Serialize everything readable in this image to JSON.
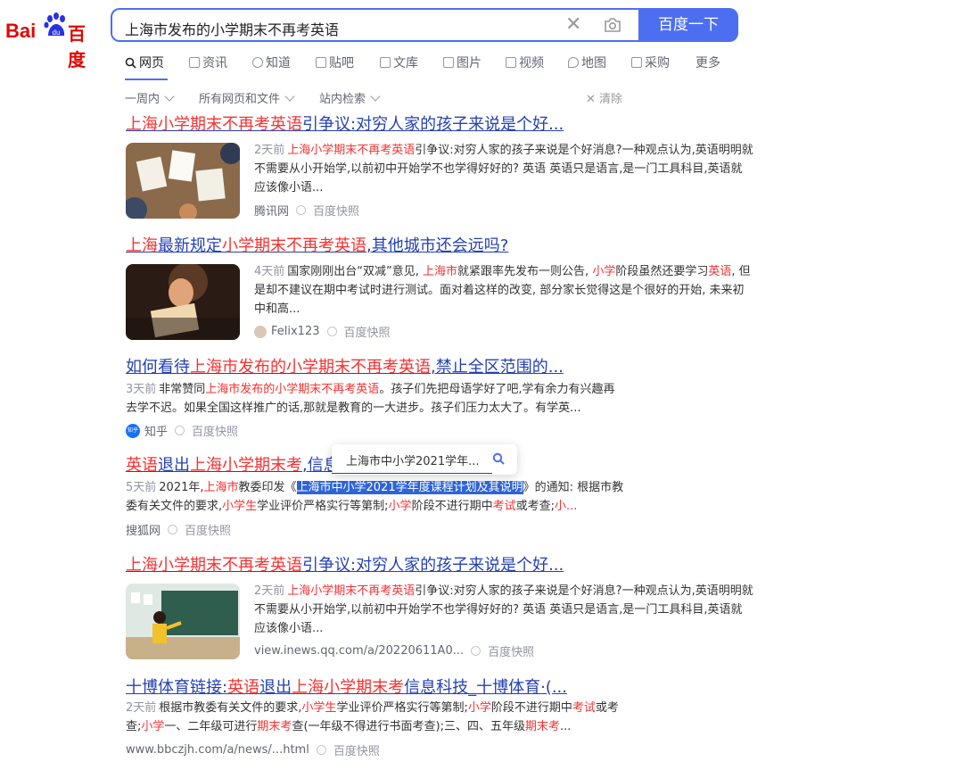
{
  "logo": {
    "latin": "Bai",
    "paw_letters": "du",
    "chinese": "百度"
  },
  "search": {
    "query": "上海市发布的小学期末不再考英语",
    "button": "百度一下"
  },
  "tabs": [
    "网页",
    "资讯",
    "知道",
    "贴吧",
    "文库",
    "图片",
    "视频",
    "地图",
    "采购",
    "更多"
  ],
  "filters": {
    "time": "一周内",
    "type": "所有网页和文件",
    "site": "站内检索",
    "clear": "清除"
  },
  "snapshot_label": "百度快照",
  "results": [
    {
      "title_parts": [
        [
          "上海小学期末不再考英语",
          true
        ],
        [
          "引争议:对穷人家的孩子来说是个好...",
          false
        ]
      ],
      "date": "2天前",
      "snippet_parts": [
        [
          "上海小学期末不再考英语",
          true
        ],
        [
          "引争议:对穷人家的孩子来说是个好消息?一种观点认为,英语明明就不需要从小开始学,以前初中开始学不也学得好好的? 英语 英语只是语言,是一门工具科目,英语就应该像小语...",
          false
        ]
      ],
      "source": "腾讯网"
    },
    {
      "title_parts": [
        [
          "上海",
          true
        ],
        [
          "最新规定",
          false
        ],
        [
          "小学期末不再考英语",
          true
        ],
        [
          ",其他城市还会远吗?",
          false
        ]
      ],
      "date": "4天前",
      "snippet_parts": [
        [
          "国家刚刚出台“双减”意见, ",
          false
        ],
        [
          "上海市",
          true
        ],
        [
          "就紧跟率先发布一则公告, ",
          false
        ],
        [
          "小学",
          true
        ],
        [
          "阶段虽然还要学习",
          false
        ],
        [
          "英语",
          true
        ],
        [
          ", 但是却不建议在期中考试时进行测试。面对着这样的改变, 部分家长觉得这是个很好的开始, 未来初中和高...",
          false
        ]
      ],
      "source": "Felix123"
    },
    {
      "title_parts": [
        [
          "如何看待",
          false
        ],
        [
          "上海市发布的小学期末不再考英语",
          true
        ],
        [
          ",禁止全区范围的...",
          false
        ]
      ],
      "date": "3天前",
      "snippet_parts": [
        [
          "非常赞同",
          false
        ],
        [
          "上海市发布的小学期末不再考英语",
          true
        ],
        [
          "。孩子们先把母语学好了吧,学有余力有兴趣再去学不迟。如果全国这样推广的话,那就是教育的一大进步。孩子们压力太大了。有学英...",
          false
        ]
      ],
      "source": "知乎",
      "source_badge": "知乎"
    },
    {
      "title_parts": [
        [
          "英语",
          true
        ],
        [
          "退出",
          false
        ],
        [
          "上海小学期末考",
          true
        ],
        [
          ",信息",
          false
        ]
      ],
      "date": "5天前",
      "snippet_parts": [
        [
          "2021年,",
          false
        ],
        [
          "上海市",
          true
        ],
        [
          "教委印发《",
          false
        ],
        [
          "上海市中小学2021学年度课程计划及其说明",
          "sel"
        ],
        [
          "》的通知: 根据市教委有关文件的要求,",
          false
        ],
        [
          "小学生",
          true
        ],
        [
          "学业评价严格实行等第制;",
          false
        ],
        [
          "小学",
          true
        ],
        [
          "阶段不进行期中",
          false
        ],
        [
          "考试",
          true
        ],
        [
          "或考查;",
          false
        ],
        [
          "小...",
          true
        ]
      ],
      "source": "搜狐网"
    },
    {
      "title_parts": [
        [
          "上海小学期末不再考英语",
          true
        ],
        [
          "引争议:对穷人家的孩子来说是个好...",
          false
        ]
      ],
      "date": "2天前",
      "snippet_parts": [
        [
          "上海小学期末不再考英语",
          true
        ],
        [
          "引争议:对穷人家的孩子来说是个好消息?一种观点认为,英语明明就不需要从小开始学,以前初中开始学不也学得好好的? 英语 英语只是语言,是一门工具科目,英语就应该像小语...",
          false
        ]
      ],
      "source": "view.inews.qq.com/a/20220611A0..."
    },
    {
      "title_parts": [
        [
          "十博体育链接:",
          false
        ],
        [
          "英语",
          true
        ],
        [
          "退出",
          false
        ],
        [
          "上海小学期末考",
          true
        ],
        [
          "信息科技_十博体育·(...",
          false
        ]
      ],
      "date": "2天前",
      "snippet_parts": [
        [
          "根据市教委有关文件的要求,",
          false
        ],
        [
          "小学生",
          true
        ],
        [
          "学业评价严格实行等第制;",
          false
        ],
        [
          "小学",
          true
        ],
        [
          "阶段不进行期中",
          false
        ],
        [
          "考试",
          true
        ],
        [
          "或考查;",
          false
        ],
        [
          "小学",
          true
        ],
        [
          "一、二年级可进行",
          false
        ],
        [
          "期末考",
          true
        ],
        [
          "查(一年级不得进行书面考查);三、四、五年级",
          false
        ],
        [
          "期末考",
          true
        ],
        [
          "...",
          false
        ]
      ],
      "source": "www.bbczjh.com/a/news/...html"
    }
  ],
  "popup": {
    "text": "上海市中小学2021学年..."
  }
}
